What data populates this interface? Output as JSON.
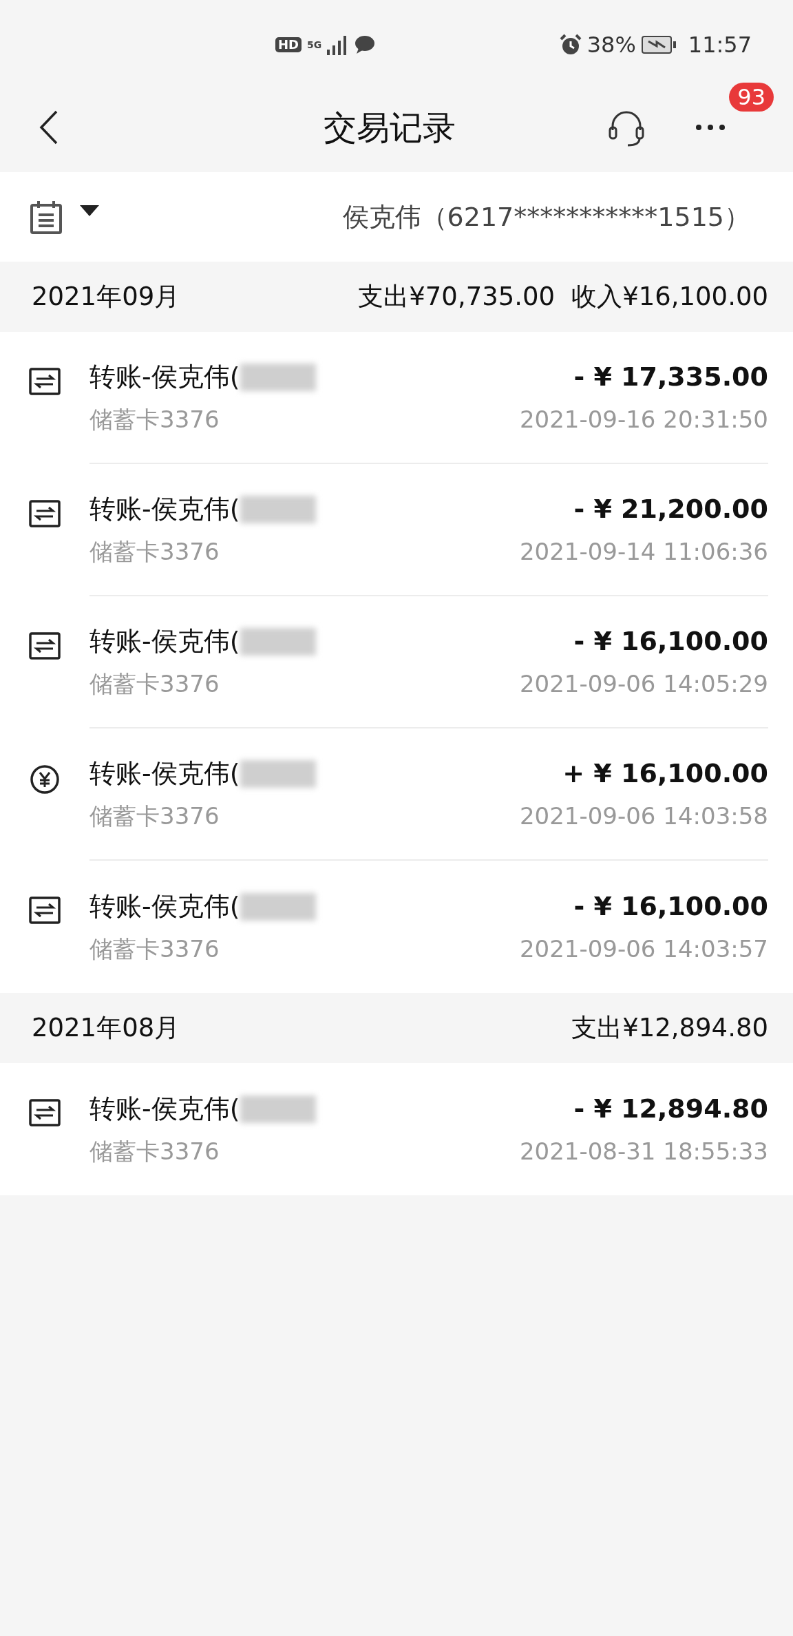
{
  "status_bar": {
    "hd_badge": "HD",
    "network": "5G",
    "battery": "38%",
    "time": "11:57"
  },
  "header": {
    "title": "交易记录",
    "notification_count": "93"
  },
  "account": {
    "holder": "侯克伟（6217***********1515）"
  },
  "months": [
    {
      "label": "2021年09月",
      "totals": [
        "支出¥70,735.00",
        "收入¥16,100.00"
      ],
      "transactions": [
        {
          "kind": "transfer",
          "title": "转账-侯克伟(",
          "card": "储蓄卡3376",
          "amount": "- ¥ 17,335.00",
          "time": "2021-09-16 20:31:50"
        },
        {
          "kind": "transfer",
          "title": "转账-侯克伟(",
          "card": "储蓄卡3376",
          "amount": "- ¥ 21,200.00",
          "time": "2021-09-14 11:06:36"
        },
        {
          "kind": "transfer",
          "title": "转账-侯克伟(",
          "card": "储蓄卡3376",
          "amount": "- ¥ 16,100.00",
          "time": "2021-09-06 14:05:29"
        },
        {
          "kind": "income",
          "title": "转账-侯克伟(",
          "card": "储蓄卡3376",
          "amount": "+ ¥ 16,100.00",
          "time": "2021-09-06 14:03:58"
        },
        {
          "kind": "transfer",
          "title": "转账-侯克伟(",
          "card": "储蓄卡3376",
          "amount": "- ¥ 16,100.00",
          "time": "2021-09-06 14:03:57"
        }
      ]
    },
    {
      "label": "2021年08月",
      "totals": [
        "支出¥12,894.80"
      ],
      "transactions": [
        {
          "kind": "transfer",
          "title": "转账-侯克伟(",
          "card": "储蓄卡3376",
          "amount": "- ¥ 12,894.80",
          "time": "2021-08-31 18:55:33"
        }
      ]
    }
  ]
}
